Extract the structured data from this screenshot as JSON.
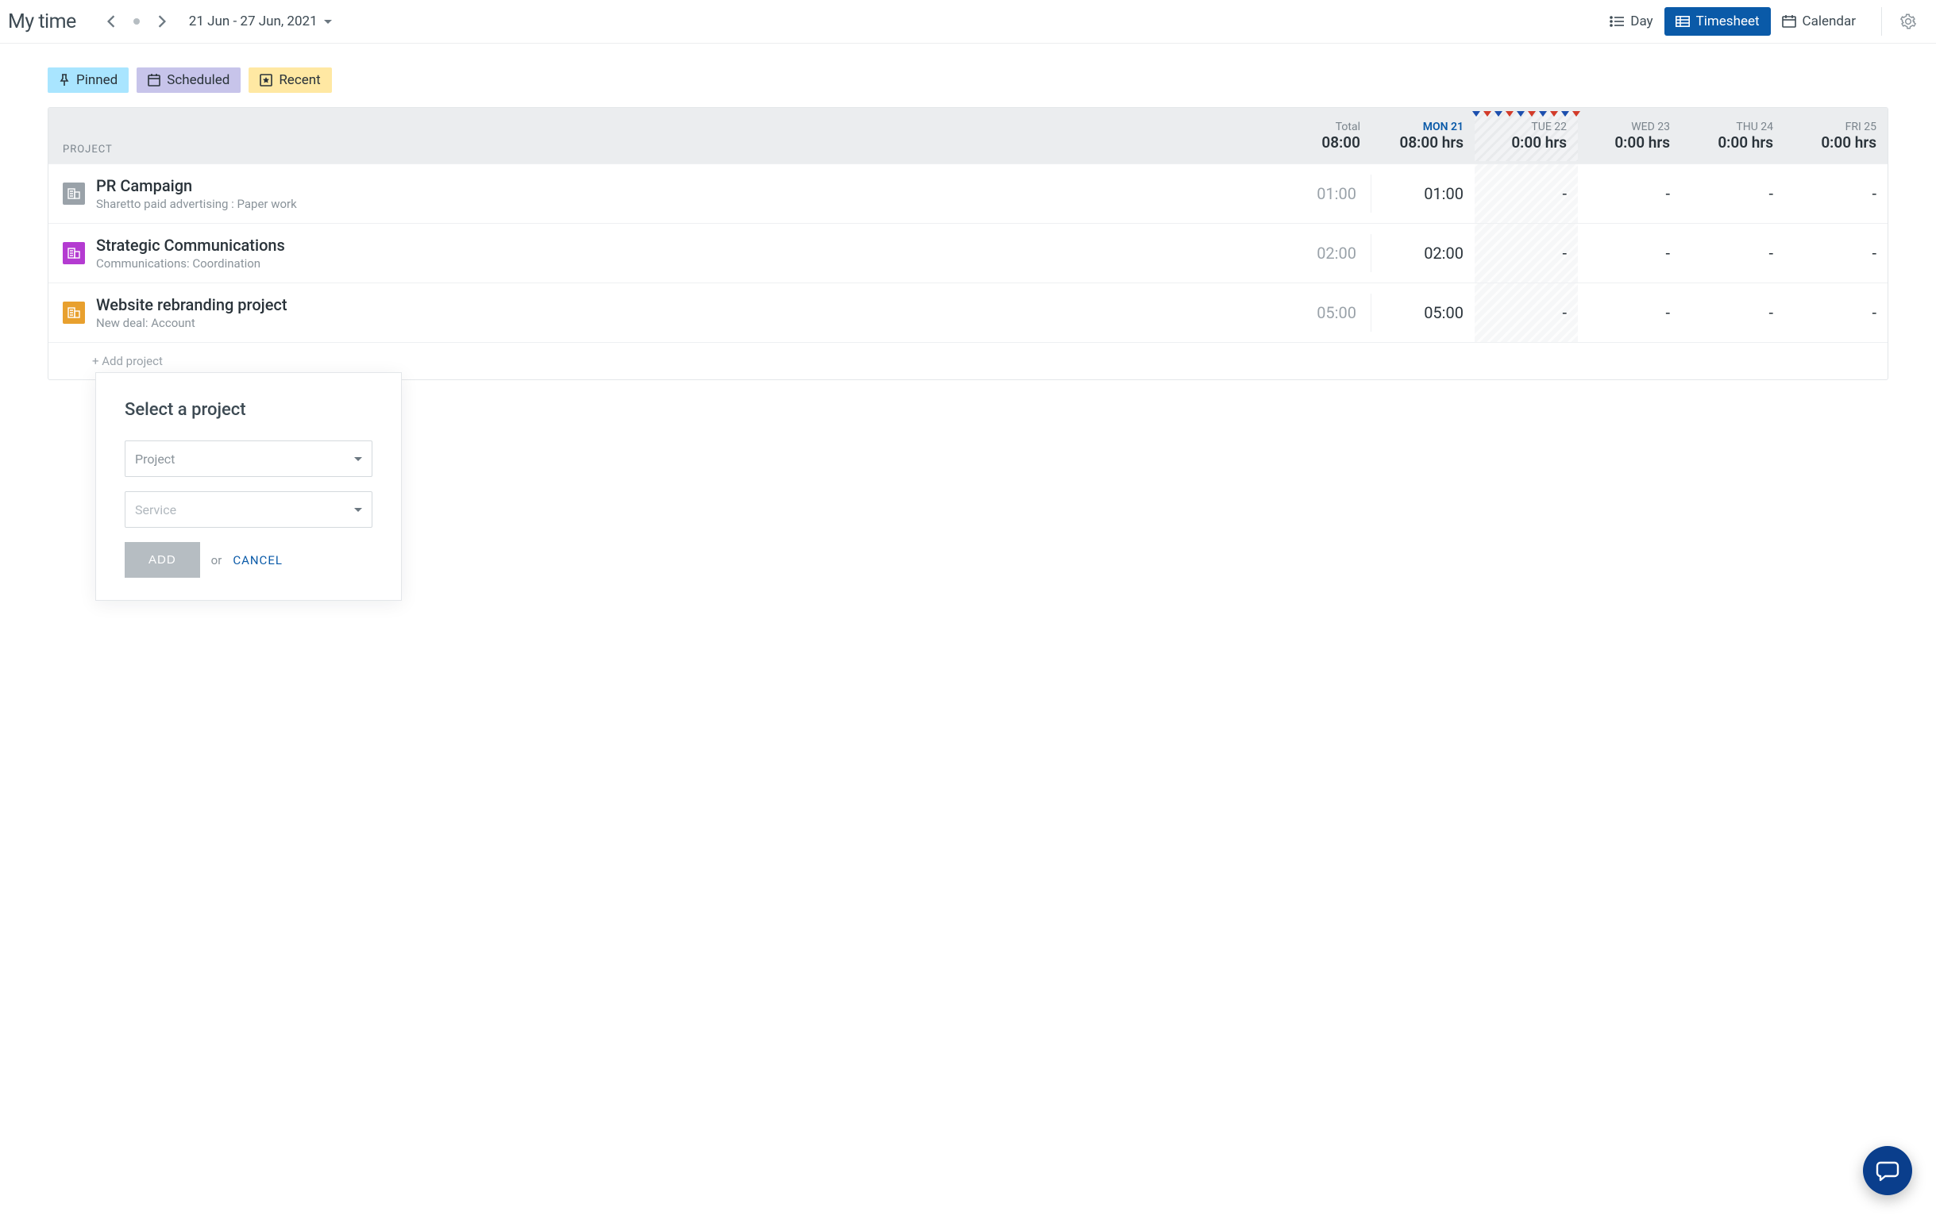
{
  "header": {
    "title": "My time",
    "date_range": "21 Jun - 27 Jun, 2021",
    "views": {
      "day": "Day",
      "timesheet": "Timesheet",
      "calendar": "Calendar"
    }
  },
  "legend": {
    "pinned": "Pinned",
    "scheduled": "Scheduled",
    "recent": "Recent"
  },
  "columns": {
    "project_label": "PROJECT",
    "total": {
      "label": "Total",
      "value": "08:00"
    },
    "days": [
      {
        "label": "MON 21",
        "value": "08:00 hrs",
        "active": true,
        "shaded": false
      },
      {
        "label": "TUE 22",
        "value": "0:00 hrs",
        "active": false,
        "shaded": true
      },
      {
        "label": "WED 23",
        "value": "0:00 hrs",
        "active": false,
        "shaded": false
      },
      {
        "label": "THU 24",
        "value": "0:00 hrs",
        "active": false,
        "shaded": false
      },
      {
        "label": "FRI 25",
        "value": "0:00 hrs",
        "active": false,
        "shaded": false
      }
    ]
  },
  "rows": [
    {
      "icon_color": "#9aa2a9",
      "title": "PR Campaign",
      "subtitle": "Sharetto paid advertising : Paper work",
      "total": "01:00",
      "cells": [
        "01:00",
        "-",
        "-",
        "-",
        "-"
      ]
    },
    {
      "icon_color": "#b43bd1",
      "title": "Strategic Communications",
      "subtitle": "Communications: Coordination",
      "total": "02:00",
      "cells": [
        "02:00",
        "-",
        "-",
        "-",
        "-"
      ]
    },
    {
      "icon_color": "#e8a02e",
      "title": "Website rebranding project",
      "subtitle": "New deal: Account",
      "total": "05:00",
      "cells": [
        "05:00",
        "-",
        "-",
        "-",
        "-"
      ]
    }
  ],
  "add_project_link": "+ Add project",
  "popover": {
    "title": "Select a project",
    "project_placeholder": "Project",
    "service_placeholder": "Service",
    "add": "ADD",
    "or": "or",
    "cancel": "CANCEL"
  }
}
